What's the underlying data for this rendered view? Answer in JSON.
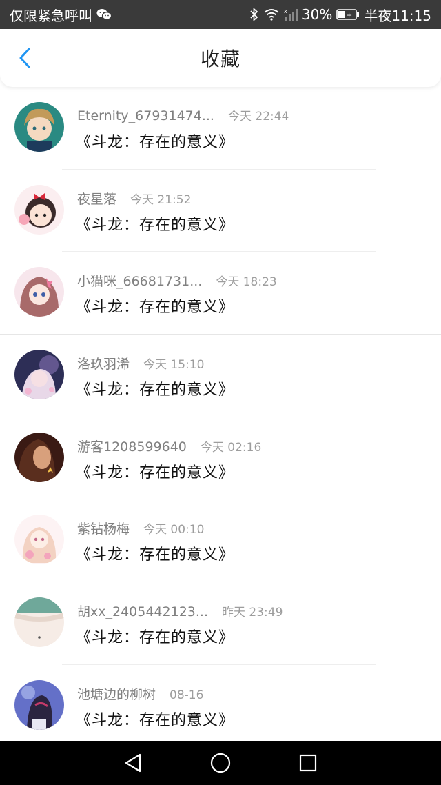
{
  "status_bar": {
    "carrier_text": "仅限紧急呼叫",
    "battery_percent": "30%",
    "time": "半夜11:15",
    "icons": [
      "wechat-icon",
      "bluetooth-icon",
      "wifi-icon",
      "signal-icon",
      "battery-icon"
    ]
  },
  "header": {
    "title": "收藏",
    "back_icon": "chevron-left-icon",
    "accent_color": "#2196f3"
  },
  "favorites": [
    {
      "username": "Eternity_67931474...",
      "time": "今天 22:44",
      "message": "《斗龙：存在的意义》"
    },
    {
      "username": "夜星落",
      "time": "今天 21:52",
      "message": "《斗龙：存在的意义》"
    },
    {
      "username": "小猫咪_66681731...",
      "time": "今天 18:23",
      "message": "《斗龙：存在的意义》"
    },
    {
      "username": "洛玖羽浠",
      "time": "今天 15:10",
      "message": "《斗龙：存在的意义》"
    },
    {
      "username": "游客1208599640",
      "time": "今天 02:16",
      "message": "《斗龙：存在的意义》"
    },
    {
      "username": "紫钻杨梅",
      "time": "今天 00:10",
      "message": "《斗龙：存在的意义》"
    },
    {
      "username": "胡xx_2405442123...",
      "time": "昨天 23:49",
      "message": "《斗龙：存在的意义》"
    },
    {
      "username": "池塘边的柳树",
      "time": "08-16",
      "message": "《斗龙：存在的意义》"
    }
  ],
  "nav_bar": {
    "icons": [
      "back-triangle-icon",
      "home-circle-icon",
      "recents-square-icon"
    ]
  }
}
